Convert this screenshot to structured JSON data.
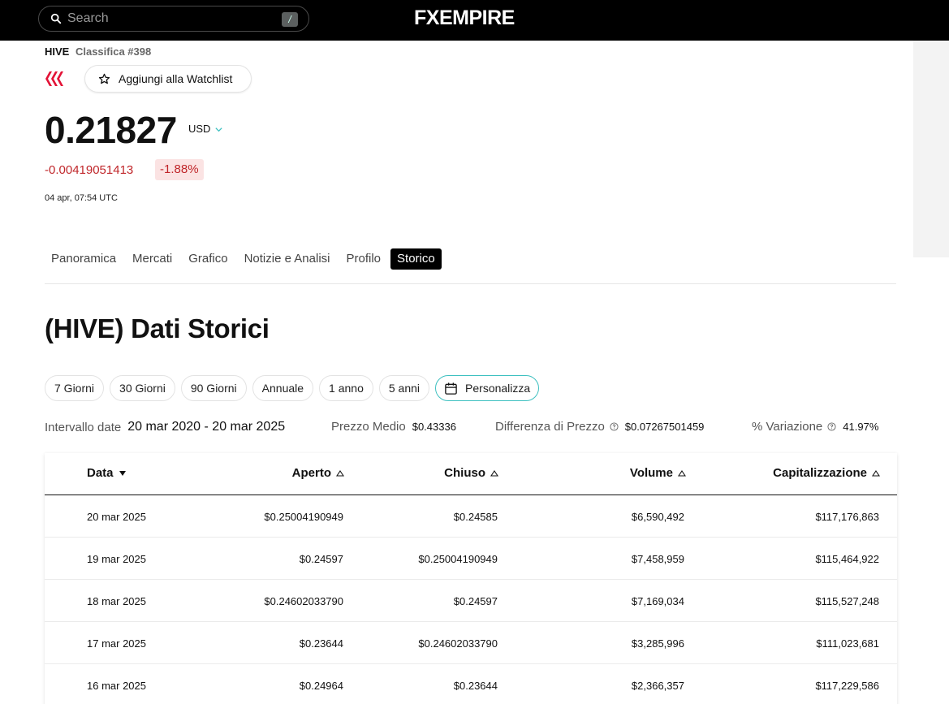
{
  "search": {
    "placeholder": "Search",
    "shortcut": "/"
  },
  "brand": {
    "logo_text": "FXEMPIRE"
  },
  "asset": {
    "symbol": "HIVE",
    "rank": "Classifica #398",
    "watchlist_label": "Aggiungi alla Watchlist",
    "price": "0.21827",
    "currency": "USD",
    "change_abs": "-0.00419051413",
    "change_pct": "-1.88%",
    "timestamp": "04 apr, 07:54 UTC"
  },
  "tabs": [
    {
      "label": "Panoramica"
    },
    {
      "label": "Mercati"
    },
    {
      "label": "Grafico"
    },
    {
      "label": "Notizie e Analisi"
    },
    {
      "label": "Profilo"
    },
    {
      "label": "Storico",
      "active": true
    }
  ],
  "page_title": "(HIVE) Dati Storici",
  "periods": [
    "7 Giorni",
    "30 Giorni",
    "90 Giorni",
    "Annuale",
    "1 anno",
    "5 anni"
  ],
  "custom_period_label": "Personalizza",
  "stats": {
    "range_label": "Intervallo date",
    "range_value": "20 mar 2020 - 20 mar 2025",
    "avg_label": "Prezzo Medio",
    "avg_value": "$0.43336",
    "diff_label": "Differenza di Prezzo",
    "diff_value": "$0.07267501459",
    "pct_label": "% Variazione",
    "pct_value": "41.97%"
  },
  "table": {
    "columns": [
      "Data",
      "Aperto",
      "Chiuso",
      "Volume",
      "Capitalizzazione"
    ],
    "rows": [
      [
        "20 mar 2025",
        "$0.25004190949",
        "$0.24585",
        "$6,590,492",
        "$117,176,863"
      ],
      [
        "19 mar 2025",
        "$0.24597",
        "$0.25004190949",
        "$7,458,959",
        "$115,464,922"
      ],
      [
        "18 mar 2025",
        "$0.24602033790",
        "$0.24597",
        "$7,169,034",
        "$115,527,248"
      ],
      [
        "17 mar 2025",
        "$0.23644",
        "$0.24602033790",
        "$3,285,996",
        "$111,023,681"
      ],
      [
        "16 mar 2025",
        "$0.24964",
        "$0.23644",
        "$2,366,357",
        "$117,229,586"
      ]
    ]
  },
  "colors": {
    "negative": "#c0262a",
    "accent": "#3ec0c0",
    "hive_red": "#e31337"
  }
}
